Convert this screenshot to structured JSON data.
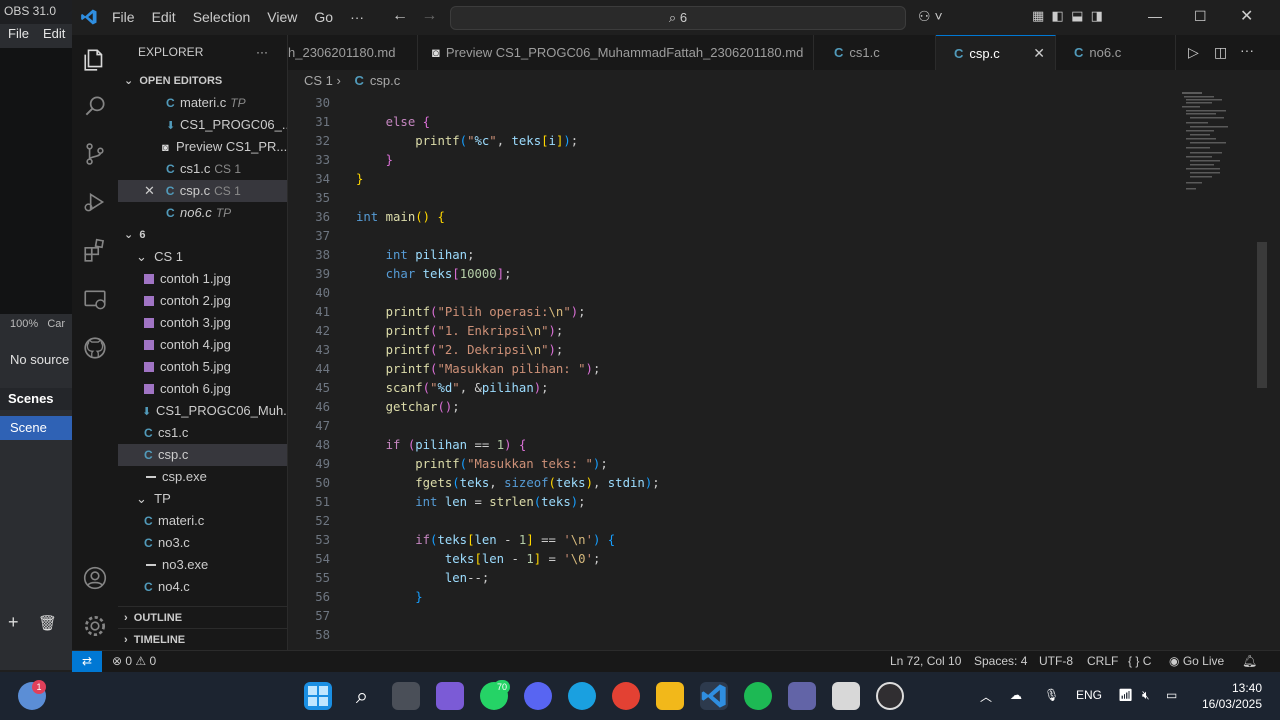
{
  "obs": {
    "title": "OBS 31.0",
    "menu": [
      "File",
      "Edit"
    ],
    "zoom": "100%",
    "zoom_suffix": "Car",
    "no_source": "No source",
    "scenes_label": "Scenes",
    "scene_item": "Scene"
  },
  "titlebar": {
    "menu": [
      "File",
      "Edit",
      "Selection",
      "View",
      "Go",
      "···"
    ],
    "search": "6"
  },
  "sidebar": {
    "explorer_title": "EXPLORER",
    "open_editors_label": "OPEN EDITORS",
    "open_editors": [
      {
        "name": "materi.c",
        "hint": "TP"
      },
      {
        "name": "CS1_PROGC06_...",
        "hint": ""
      },
      {
        "name": "Preview CS1_PR...",
        "hint": ""
      },
      {
        "name": "cs1.c",
        "hint": "CS 1"
      },
      {
        "name": "csp.c",
        "hint": "CS 1"
      },
      {
        "name": "no6.c",
        "hint": "TP"
      }
    ],
    "folder_root": "6",
    "folder_cs1": "CS 1",
    "cs1_files": [
      "contoh 1.jpg",
      "contoh 2.jpg",
      "contoh 3.jpg",
      "contoh 4.jpg",
      "contoh 5.jpg",
      "contoh 6.jpg",
      "CS1_PROGC06_Muh...",
      "cs1.c",
      "csp.c",
      "csp.exe"
    ],
    "folder_tp": "TP",
    "tp_files": [
      "materi.c",
      "no3.c",
      "no3.exe",
      "no4.c"
    ],
    "outline_label": "OUTLINE",
    "timeline_label": "TIMELINE"
  },
  "tabs": [
    {
      "label": "h_2306201180.md"
    },
    {
      "label": "Preview CS1_PROGC06_MuhammadFattah_2306201180.md"
    },
    {
      "label": "cs1.c"
    },
    {
      "label": "csp.c"
    },
    {
      "label": "no6.c"
    }
  ],
  "breadcrumb": {
    "folder": "CS 1",
    "file": "csp.c"
  },
  "status": {
    "problems": "0",
    "warnings": "0",
    "position": "Ln 72, Col 10",
    "spaces": "Spaces: 4",
    "encoding": "UTF-8",
    "eol": "CRLF",
    "language": "C",
    "golive": "Go Live"
  },
  "taskbar": {
    "whatsapp_badge": "70",
    "lang": "ENG",
    "time": "13:40",
    "date": "16/03/2025"
  },
  "code_lines": [
    30,
    31,
    32,
    33,
    34,
    35,
    36,
    37,
    38,
    39,
    40,
    41,
    42,
    43,
    44,
    45,
    46,
    47,
    48,
    49,
    50,
    51,
    52,
    53,
    54,
    55,
    56,
    57,
    58
  ]
}
